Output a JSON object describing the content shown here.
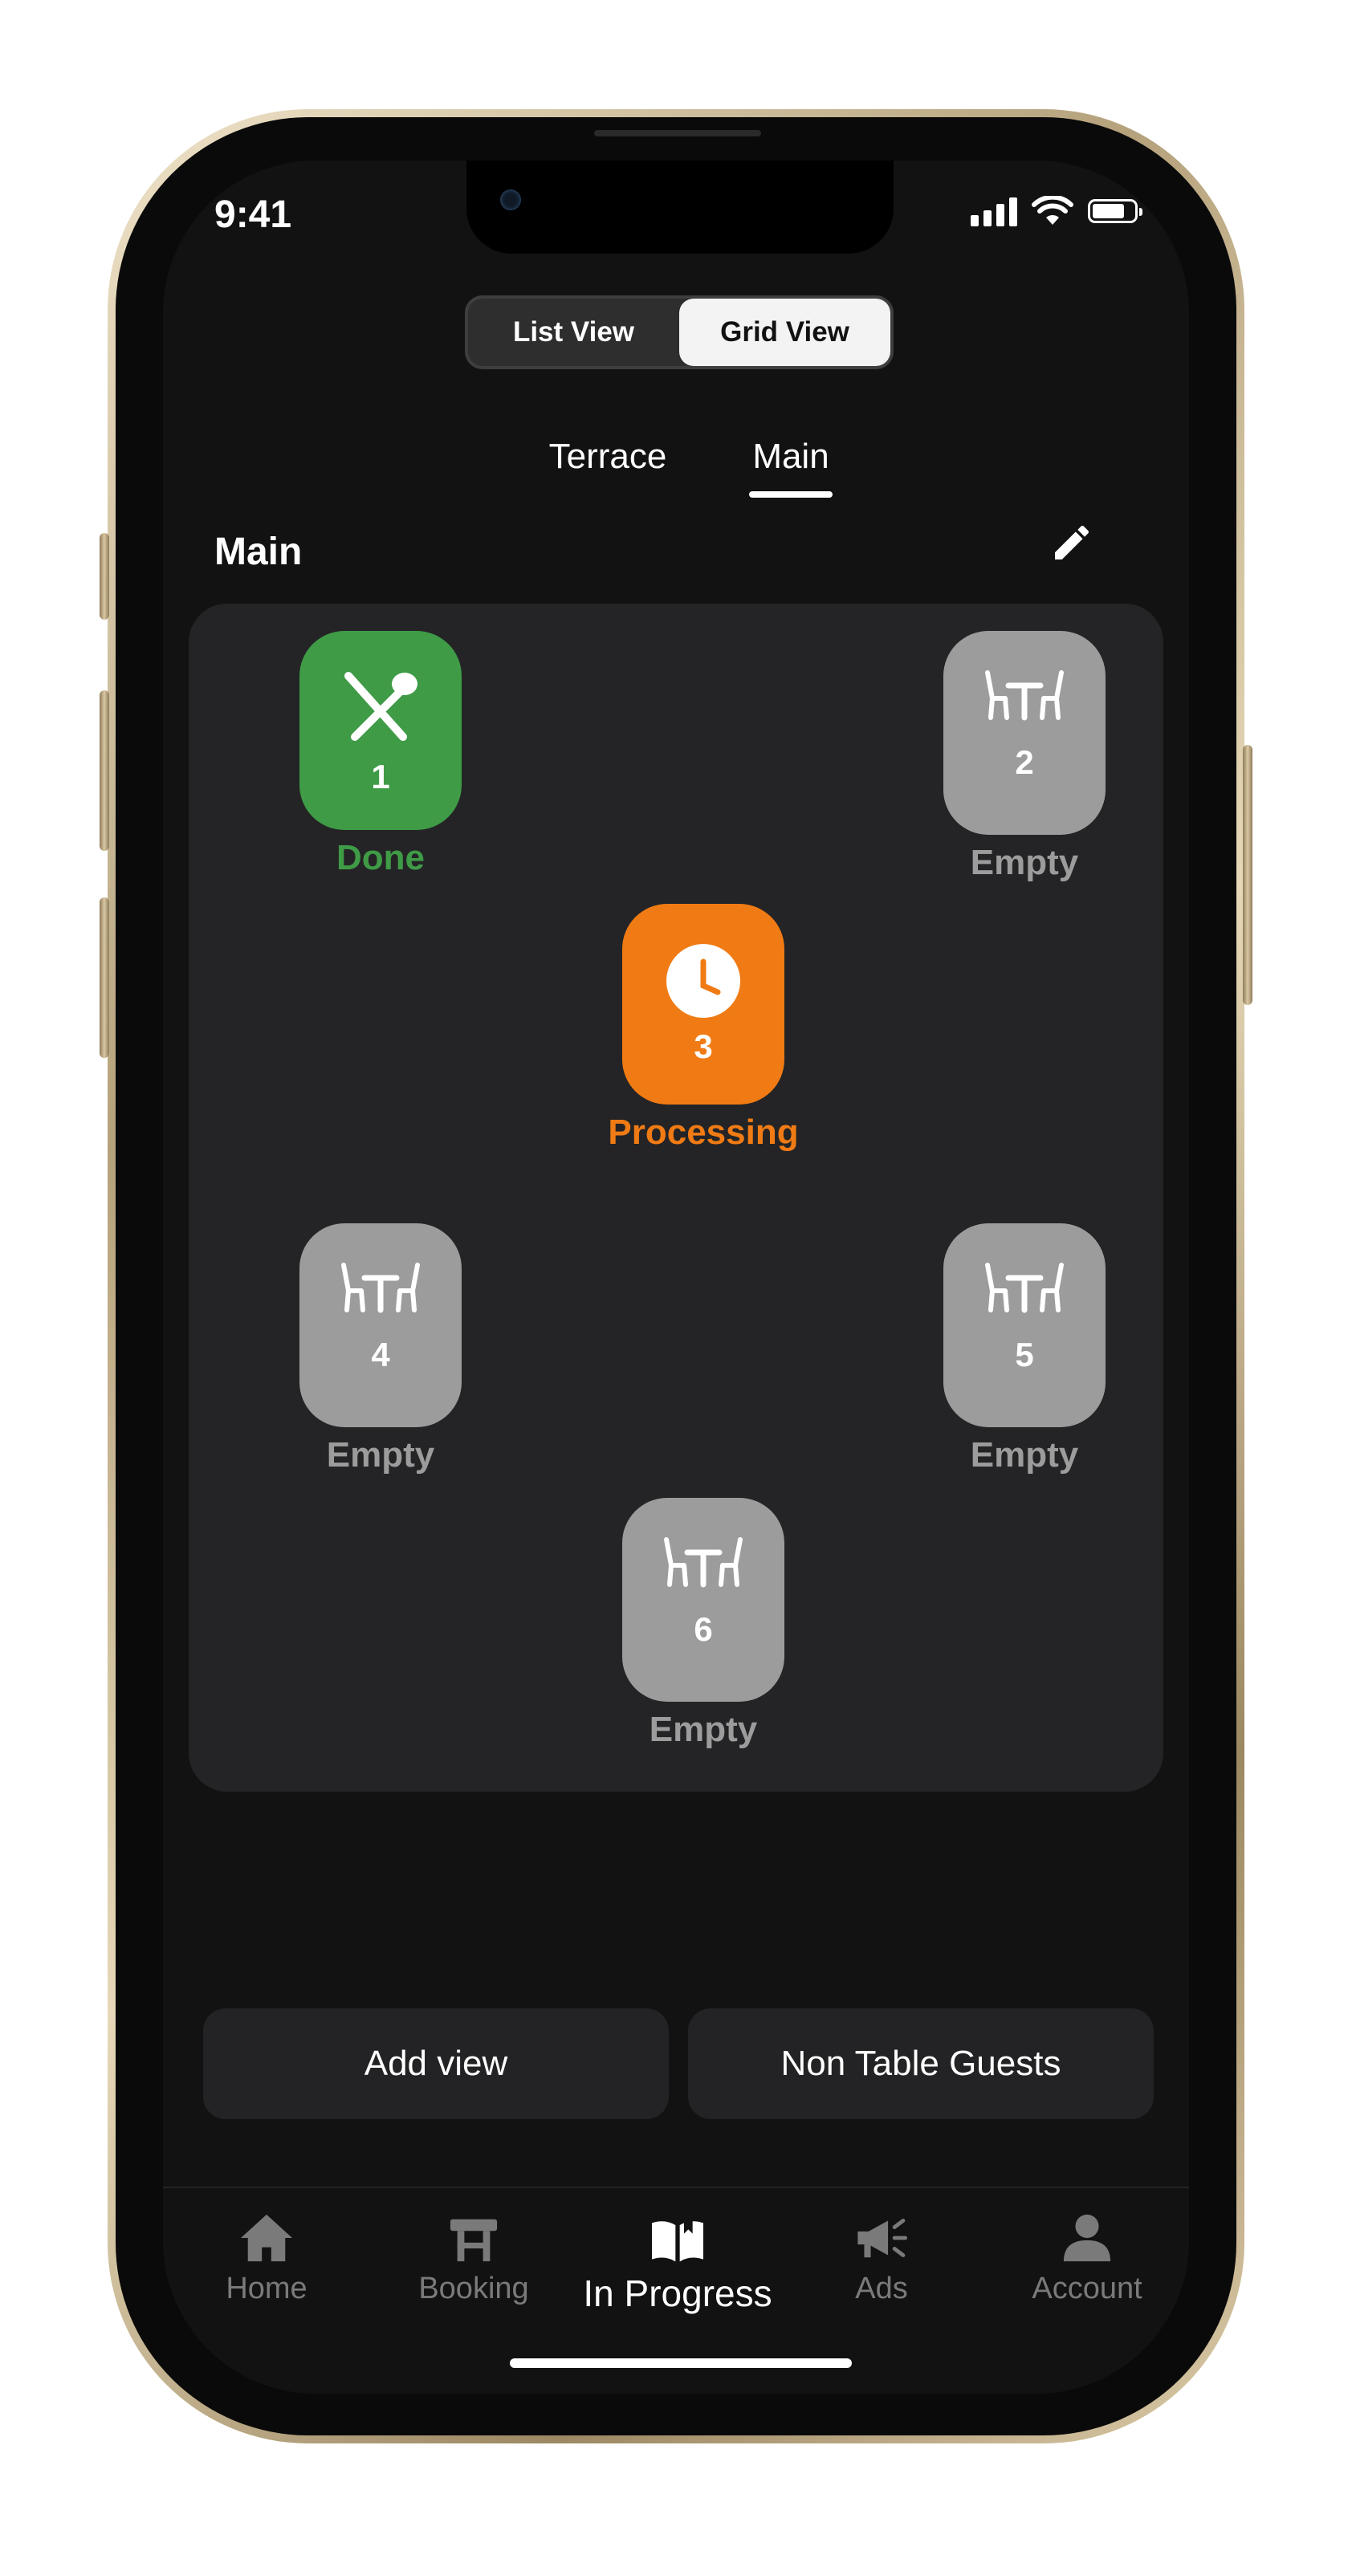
{
  "status_bar": {
    "time": "9:41"
  },
  "view_toggle": {
    "options": [
      {
        "label": "List View",
        "active": false
      },
      {
        "label": "Grid View",
        "active": true
      }
    ]
  },
  "area_tabs": [
    {
      "label": "Terrace",
      "active": false
    },
    {
      "label": "Main",
      "active": true
    }
  ],
  "section": {
    "title": "Main",
    "edit_icon": "pencil-icon"
  },
  "tables": [
    {
      "number": "1",
      "status": "Done",
      "icon": "fork-spoon-icon",
      "color": "#3f9b46"
    },
    {
      "number": "2",
      "status": "Empty",
      "icon": "table-chairs-icon",
      "color": "#9c9c9c"
    },
    {
      "number": "3",
      "status": "Processing",
      "icon": "clock-icon",
      "color": "#f07b14"
    },
    {
      "number": "4",
      "status": "Empty",
      "icon": "table-chairs-icon",
      "color": "#9c9c9c"
    },
    {
      "number": "5",
      "status": "Empty",
      "icon": "table-chairs-icon",
      "color": "#9c9c9c"
    },
    {
      "number": "6",
      "status": "Empty",
      "icon": "table-chairs-icon",
      "color": "#9c9c9c"
    }
  ],
  "actions": {
    "add_view": "Add view",
    "non_table_guests": "Non Table Guests"
  },
  "nav": [
    {
      "label": "Home",
      "icon": "home-icon",
      "active": false
    },
    {
      "label": "Booking",
      "icon": "table-icon",
      "active": false
    },
    {
      "label": "In Progress",
      "icon": "open-book-icon",
      "active": true
    },
    {
      "label": "Ads",
      "icon": "megaphone-icon",
      "active": false
    },
    {
      "label": "Account",
      "icon": "person-icon",
      "active": false
    }
  ],
  "colors": {
    "done": "#3f9b46",
    "processing": "#f07b14",
    "empty": "#9c9c9c",
    "background": "#121212"
  }
}
